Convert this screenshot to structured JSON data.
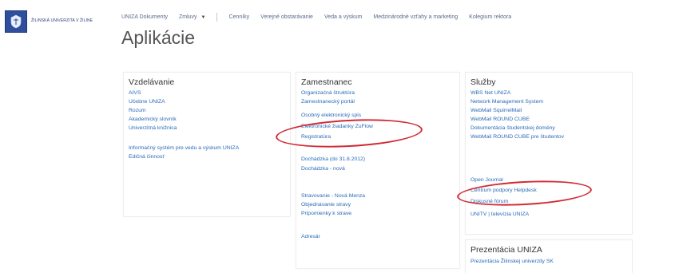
{
  "brand": {
    "logo_text": "ŽILINSKÁ UNIVERZITA V ŽILINE"
  },
  "topnav": {
    "items": [
      {
        "label": "UNIZA Dokumenty"
      },
      {
        "label": "Zmluvy"
      },
      {
        "label": "Cenníky"
      },
      {
        "label": "Verejné obstarávanie"
      },
      {
        "label": "Veda a výskum"
      },
      {
        "label": "Medzinárodné vzťahy a marketing"
      },
      {
        "label": "Kolegium rektora"
      }
    ]
  },
  "page": {
    "title": "Aplikácie"
  },
  "sections": {
    "vzdelavanie": {
      "title": "Vzdelávanie",
      "links": [
        "AIVS",
        "Učebne UNIZA",
        "Rozum",
        "Akademický slovník",
        "Univerzitná knižnica",
        "Informačný systém pre vedu a výskum UNIZA",
        "Edičná činnosť"
      ]
    },
    "zamestnanec": {
      "title": "Zamestnanec",
      "links": [
        "Organizačná štruktúra",
        "Zamestnanecký portál",
        "Osobný elektronický spis",
        "Elektronické žiadanky ZuFlow",
        "Registratúra",
        "Dochádzka (do 31.8.2012)",
        "Dochádzka - nová",
        "Stravovanie - Nová Menza",
        "Objednávanie stravy",
        "Pripomienky k strave",
        "Adresár"
      ]
    },
    "sluzby": {
      "title": "Služby",
      "links": [
        "WBS Net UNIZA",
        "Network Management System",
        "WebMail SquirrelMail",
        "WebMail ROUND CUBE",
        "Dokumentácia študentskej domény",
        "WebMail ROUND CUBE pre študentov",
        "Open Journal",
        "Centrum podpory Helpdesk",
        "Diskusné fórum",
        "UNITV | televízia UNIZA"
      ]
    },
    "prezentacia": {
      "title": "Prezentácia UNIZA",
      "links": [
        "Prezentácia Žilinskej univerzity SK"
      ]
    }
  },
  "colors": {
    "link": "#2a6bb8",
    "highlight_oval": "#d22a35",
    "logo_bg": "#2f4f9c"
  }
}
